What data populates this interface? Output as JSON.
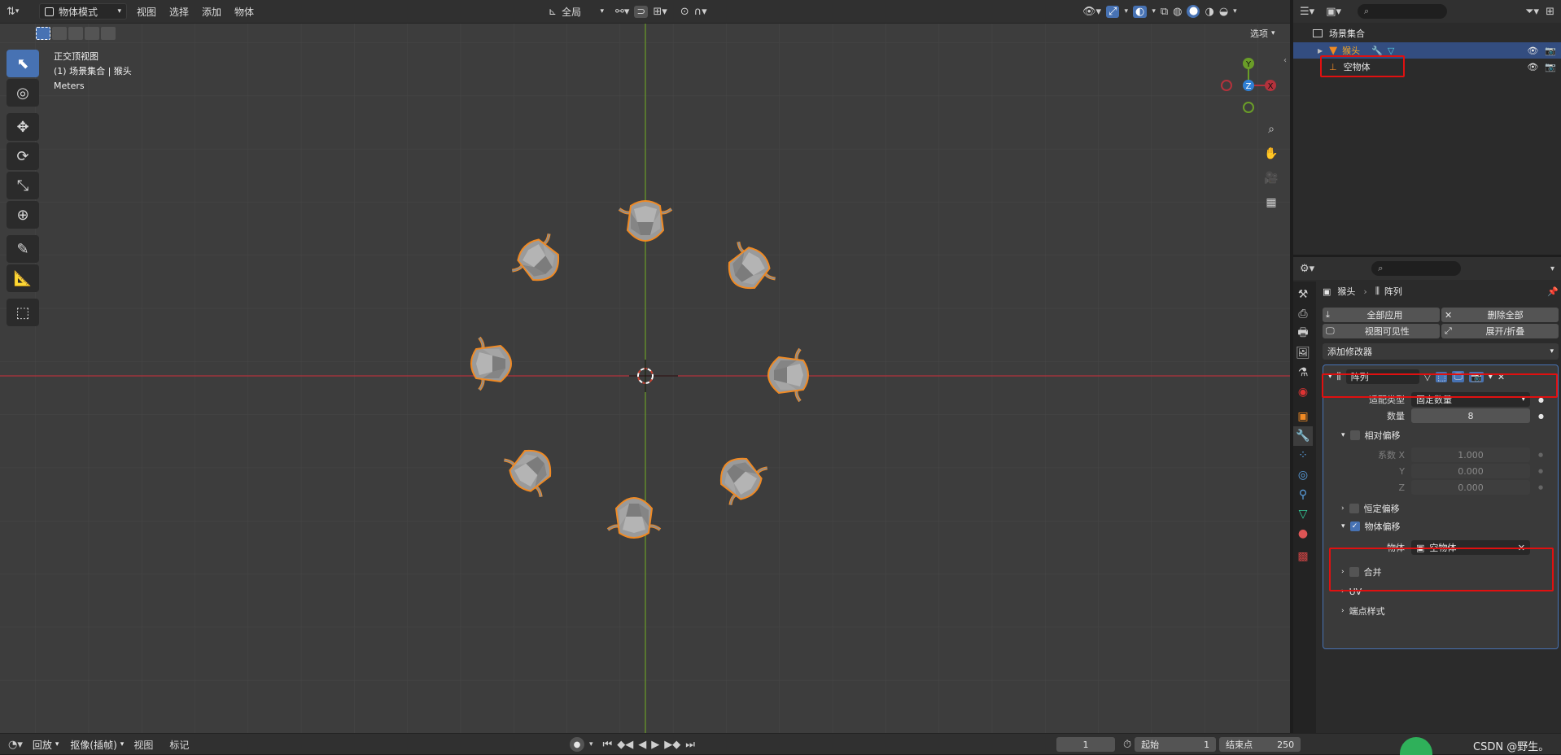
{
  "header": {
    "mode_label": "物体模式",
    "menus": [
      "视图",
      "选择",
      "添加",
      "物体"
    ],
    "transform_space": "全局",
    "options_label": "选项"
  },
  "viewport": {
    "view_name": "正交顶视图",
    "collection_info": "(1) 场景集合 | 猴头",
    "units": "Meters",
    "gizmo": {
      "y": "Y",
      "z": "Z",
      "x": "X"
    }
  },
  "outliner": {
    "root": "场景集合",
    "items": [
      {
        "label": "猴头",
        "selected": true
      },
      {
        "label": "空物体",
        "selected": false
      }
    ]
  },
  "properties": {
    "breadcrumb": {
      "object": "猴头",
      "modifier": "阵列"
    },
    "apply_all": "全部应用",
    "delete_all": "删除全部",
    "viewport_visibility": "视图可见性",
    "expand_collapse": "展开/折叠",
    "add_modifier": "添加修改器",
    "modifier": {
      "name": "阵列",
      "fit_type_label": "适配类型",
      "fit_type_value": "固定数量",
      "count_label": "数量",
      "count_value": "8",
      "relative_offset": "相对偏移",
      "factor_x_label": "系数 X",
      "factor_x": "1.000",
      "y_label": "Y",
      "factor_y": "0.000",
      "z_label": "Z",
      "factor_z": "0.000",
      "constant_offset": "恒定偏移",
      "object_offset": "物体偏移",
      "object_label": "物体",
      "object_value": "空物体",
      "merge": "合并",
      "uv": "UV",
      "caps": "端点样式"
    }
  },
  "timeline": {
    "playback": "回放",
    "keying": "抠像(插帧)",
    "view": "视图",
    "marker": "标记",
    "current_frame": "1",
    "start_label": "起始",
    "start_value": "1",
    "end_label": "结束点",
    "end_value": "250"
  },
  "watermark": "CSDN @野生。",
  "colors": {
    "selection_outline": "#f08a24",
    "accent": "#4772b3",
    "x_axis": "#b3323c",
    "y_axis": "#6a9d28",
    "highlight_box": "#e01010"
  }
}
